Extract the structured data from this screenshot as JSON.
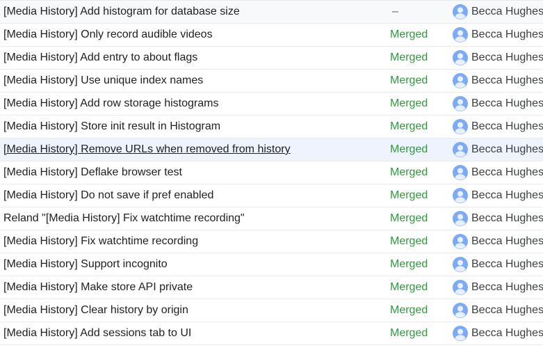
{
  "changes": [
    {
      "subject": "[Media History] Add histogram for database size",
      "status": "–",
      "owner": "Becca Hughes"
    },
    {
      "subject": "[Media History] Only record audible videos",
      "status": "Merged",
      "owner": "Becca Hughes"
    },
    {
      "subject": "[Media History] Add entry to about flags",
      "status": "Merged",
      "owner": "Becca Hughes"
    },
    {
      "subject": "[Media History] Use unique index names",
      "status": "Merged",
      "owner": "Becca Hughes"
    },
    {
      "subject": "[Media History] Add row storage histograms",
      "status": "Merged",
      "owner": "Becca Hughes"
    },
    {
      "subject": "[Media History] Store init result in Histogram",
      "status": "Merged",
      "owner": "Becca Hughes"
    },
    {
      "subject": "[Media History] Remove URLs when removed from history",
      "status": "Merged",
      "owner": "Becca Hughes"
    },
    {
      "subject": "[Media History] Deflake browser test",
      "status": "Merged",
      "owner": "Becca Hughes"
    },
    {
      "subject": "[Media History] Do not save if pref enabled",
      "status": "Merged",
      "owner": "Becca Hughes"
    },
    {
      "subject": "Reland \"[Media History] Fix watchtime recording\"",
      "status": "Merged",
      "owner": "Becca Hughes"
    },
    {
      "subject": "[Media History] Fix watchtime recording",
      "status": "Merged",
      "owner": "Becca Hughes"
    },
    {
      "subject": "[Media History] Support incognito",
      "status": "Merged",
      "owner": "Becca Hughes"
    },
    {
      "subject": "[Media History] Make store API private",
      "status": "Merged",
      "owner": "Becca Hughes"
    },
    {
      "subject": "[Media History] Clear history by origin",
      "status": "Merged",
      "owner": "Becca Hughes"
    },
    {
      "subject": "[Media History] Add sessions tab to UI",
      "status": "Merged",
      "owner": "Becca Hughes"
    }
  ],
  "owner_avatar_icon": "account-circle-icon",
  "colors": {
    "merged": "#2e9b3a",
    "avatar": "#7baaf7",
    "hover_row": "#eef3fd"
  }
}
